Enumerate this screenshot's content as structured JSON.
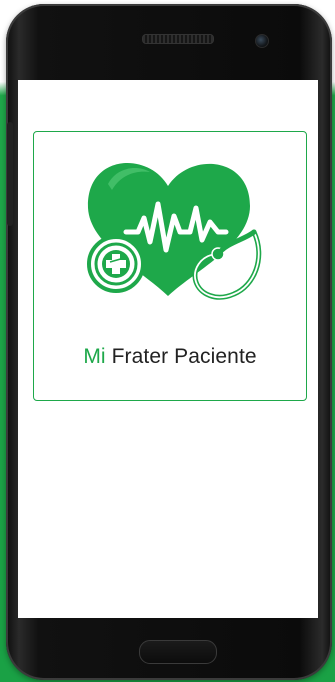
{
  "app": {
    "brand_prefix": "Mi",
    "brand_rest": " Frater Paciente"
  },
  "colors": {
    "accent": "#1ea84a",
    "text": "#222222",
    "background": "#ffffff"
  },
  "icons": {
    "logo": "heart-stethoscope-icon"
  }
}
